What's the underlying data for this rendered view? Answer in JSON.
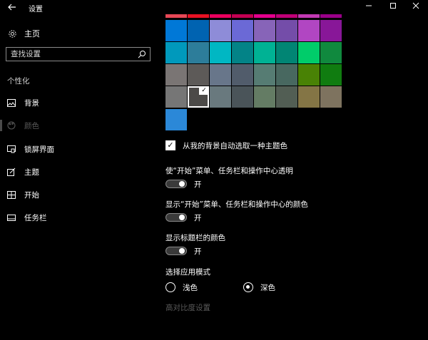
{
  "window": {
    "title": "设置",
    "back_icon": "arrow-left-icon",
    "controls": [
      "minimize-icon",
      "maximize-icon",
      "close-icon"
    ]
  },
  "sidebar": {
    "home": {
      "icon": "gear-icon",
      "label": "主页"
    },
    "search": {
      "placeholder": "查找设置",
      "icon": "search-icon"
    },
    "section_title": "个性化",
    "items": [
      {
        "label": "背景",
        "icon": "image-icon",
        "active": false
      },
      {
        "label": "颜色",
        "icon": "palette-icon",
        "active": true
      },
      {
        "label": "锁屏界面",
        "icon": "lock-screen-icon",
        "active": false
      },
      {
        "label": "主题",
        "icon": "theme-brush-icon",
        "active": false
      },
      {
        "label": "开始",
        "icon": "start-menu-icon",
        "active": false
      },
      {
        "label": "任务栏",
        "icon": "taskbar-icon",
        "active": false
      }
    ]
  },
  "colors": {
    "swatches": [
      [
        "#0078d7",
        "#0063b1",
        "#8e8cd8",
        "#6b69d6",
        "#8764b8",
        "#744da9",
        "#b146c2",
        "#881798"
      ],
      [
        "#0099bc",
        "#2d7d9a",
        "#00b7c3",
        "#038387",
        "#00b294",
        "#018574",
        "#00cc6a",
        "#10893e"
      ],
      [
        "#7a7574",
        "#5d5a58",
        "#68768a",
        "#515c6b",
        "#567c73",
        "#486860",
        "#498205",
        "#107c10"
      ],
      [
        "#767676",
        "#4c4a48",
        "#69797e",
        "#4a5459",
        "#647c64",
        "#525e54",
        "#847545",
        "#7e735f"
      ],
      [
        "#2b88d8"
      ]
    ],
    "top_strip": [
      "#e74856",
      "#e81123",
      "#ea005e",
      "#c30052",
      "#e3008c",
      "#bf0077",
      "#c239b3",
      "#9a0089"
    ],
    "selected": {
      "row": 3,
      "col": 1
    },
    "auto_pick_label": "从我的背景自动选取一种主题色",
    "auto_pick_checked": true
  },
  "settings": {
    "transparency": {
      "label": "使“开始”菜单、任务栏和操作中心透明",
      "state": "开"
    },
    "show_start_color": {
      "label": "显示“开始”菜单、任务栏和操作中心的颜色",
      "state": "开"
    },
    "show_titlebar_color": {
      "label": "显示标题栏的颜色",
      "state": "开"
    },
    "app_mode": {
      "label": "选择应用模式",
      "options": [
        {
          "label": "浅色",
          "selected": false
        },
        {
          "label": "深色",
          "selected": true
        }
      ]
    },
    "high_contrast_link": "高对比度设置"
  }
}
